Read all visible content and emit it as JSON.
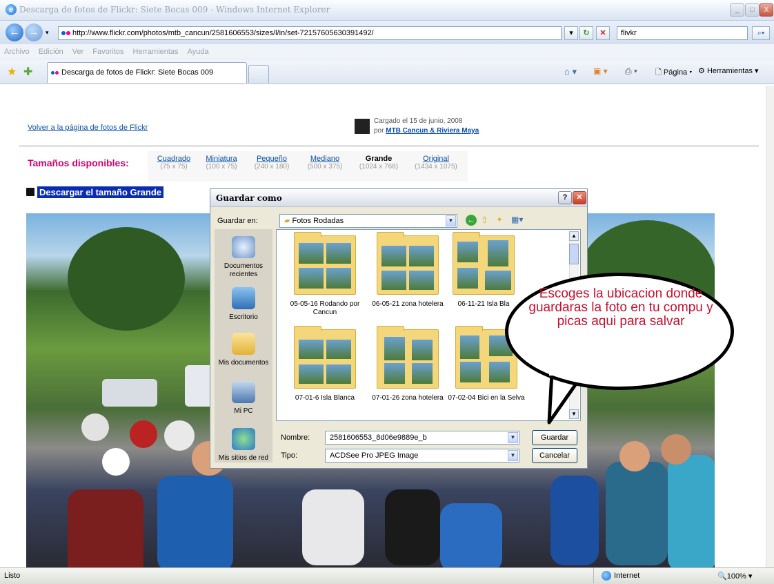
{
  "window": {
    "title": "Descarga de fotos de Flickr: Siete Bocas 009 - Windows Internet Explorer"
  },
  "address": {
    "url": "http://www.flickr.com/photos/mtb_cancun/2581606553/sizes/l/in/set-72157605630391492/",
    "search_value": "flivkr"
  },
  "menu": [
    "Archivo",
    "Edición",
    "Ver",
    "Favoritos",
    "Herramientas",
    "Ayuda"
  ],
  "tab": {
    "label": "Descarga de fotos de Flickr: Siete Bocas 009"
  },
  "toolbar": {
    "page": "Página",
    "tools": "Herramientas"
  },
  "page": {
    "back_link": "Volver a la página de fotos de Flickr",
    "uploaded_line": "Cargado el 15 de junio, 2008",
    "uploaded_by_prefix": "por",
    "uploaded_by": "MTB Cancun & Riviera Maya",
    "sizes_label": "Tamaños disponibles:",
    "sizes": [
      {
        "name": "Cuadrado",
        "dims": "(75 x 75)"
      },
      {
        "name": "Miniatura",
        "dims": "(100 x 75)"
      },
      {
        "name": "Pequeño",
        "dims": "(240 x 180)"
      },
      {
        "name": "Mediano",
        "dims": "(500 x 375)"
      },
      {
        "name": "Grande",
        "dims": "(1024 x 768)"
      },
      {
        "name": "Original",
        "dims": "(1434 x 1075)"
      }
    ],
    "download_label": "Descargar el tamaño Grande"
  },
  "dialog": {
    "title": "Guardar como",
    "save_in_label": "Guardar en:",
    "save_in_value": "Fotos Rodadas",
    "places": [
      "Documentos recientes",
      "Escritorio",
      "Mis documentos",
      "Mi PC",
      "Mis sitios de red"
    ],
    "folders": [
      "05-05-16 Rodando por Cancun",
      "06-05-21 zona hotelera",
      "06-11-21 Isla Bla",
      "07-01-6 Isla Blanca",
      "07-01-26 zona hotelera",
      "07-02-04 Bici en la Selva"
    ],
    "name_label": "Nombre:",
    "name_value": "2581606553_8d06e9889e_b",
    "type_label": "Tipo:",
    "type_value": "ACDSee Pro JPEG Image",
    "save_button": "Guardar",
    "cancel_button": "Cancelar"
  },
  "callout": {
    "text": "Escoges la ubicacion donde guardaras la foto en tu compu y picas aqui para salvar"
  },
  "status": {
    "left": "Listo",
    "zone": "Internet",
    "zoom": "100%"
  },
  "colors": {
    "sizes_label": "#d8006f",
    "link": "#0a4fa7",
    "callout_text": "#c8102e"
  }
}
